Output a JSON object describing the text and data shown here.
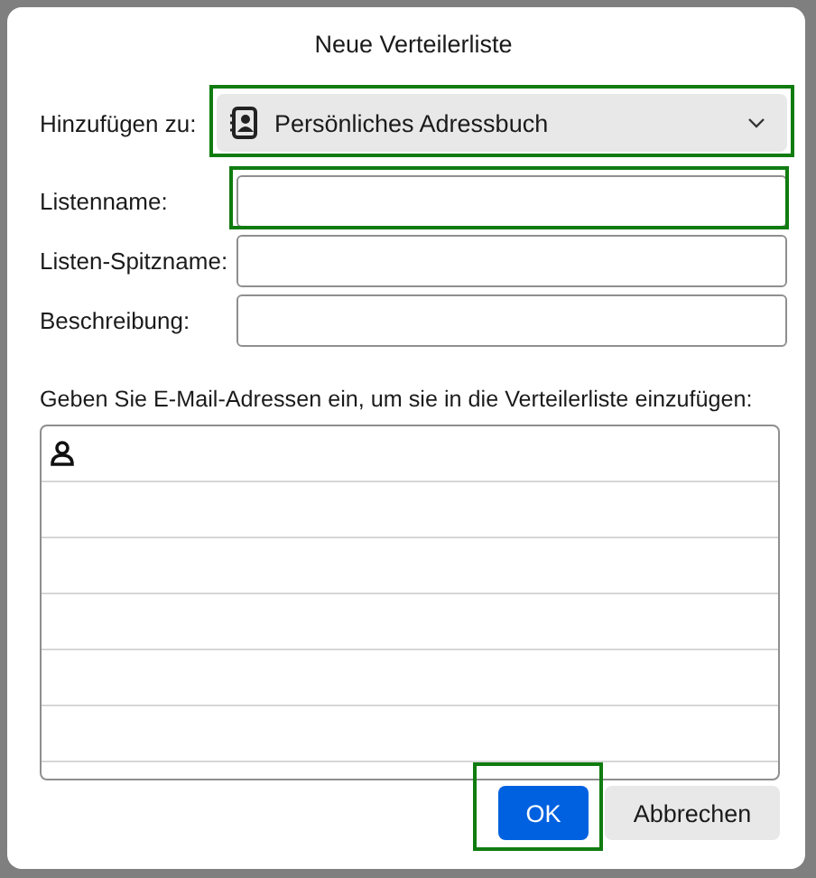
{
  "dialog": {
    "title": "Neue Verteilerliste"
  },
  "add_to": {
    "label": "Hinzufügen zu:",
    "value": "Persönliches Adressbuch",
    "highlighted": true
  },
  "fields": [
    {
      "label": "Listenname:",
      "highlighted": true
    },
    {
      "label": "Listen-Spitzname:",
      "highlighted": false
    },
    {
      "label": "Beschreibung:",
      "highlighted": false
    }
  ],
  "addresses": {
    "label": "Geben Sie E-Mail-Adressen ein, um sie in die Verteilerliste einzufügen:"
  },
  "buttons": [
    {
      "label": "OK",
      "kind": "primary",
      "highlighted": true
    },
    {
      "label": "Abbrechen",
      "kind": "secondary",
      "highlighted": false
    }
  ]
}
